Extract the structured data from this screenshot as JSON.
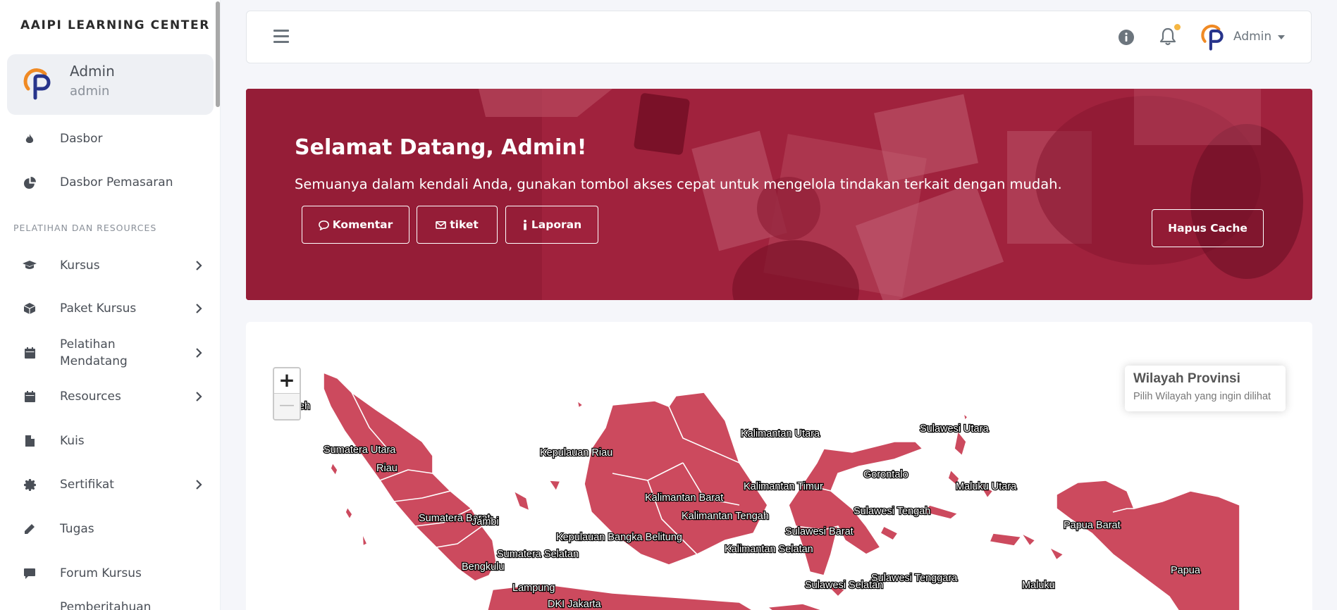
{
  "sidebar": {
    "brand": "AAIPI LEARNING CENTER",
    "user": {
      "name": "Admin",
      "role": "admin"
    },
    "section_label": "PELATIHAN DAN RESOURCES",
    "items": [
      {
        "label": "Dasbor",
        "icon": "fire-icon",
        "has_children": false
      },
      {
        "label": "Dasbor Pemasaran",
        "icon": "pie-chart-icon",
        "has_children": false
      },
      {
        "label": "Kursus",
        "icon": "graduation-cap-icon",
        "has_children": true
      },
      {
        "label": "Paket Kursus",
        "icon": "box-icon",
        "has_children": true
      },
      {
        "label": "Pelatihan Mendatang",
        "icon": "calendar-icon",
        "has_children": true
      },
      {
        "label": "Resources",
        "icon": "calendar-icon",
        "has_children": true
      },
      {
        "label": "Kuis",
        "icon": "file-icon",
        "has_children": false
      },
      {
        "label": "Sertifikat",
        "icon": "certificate-icon",
        "has_children": true
      },
      {
        "label": "Tugas",
        "icon": "pencil-icon",
        "has_children": false
      },
      {
        "label": "Forum Kursus",
        "icon": "comment-icon",
        "has_children": false
      },
      {
        "label": "Pemberitahuan",
        "icon": "bell-icon",
        "has_children": false
      }
    ]
  },
  "topbar": {
    "user_label": "Admin",
    "icons": [
      "menu-icon",
      "info-icon",
      "bell-icon"
    ],
    "notification_dot_color": "#f5b642"
  },
  "banner": {
    "title": "Selamat Datang, Admin!",
    "subtitle": "Semuanya dalam kendali Anda, gunakan tombol akses cepat untuk mengelola tindakan terkait dengan mudah.",
    "buttons": {
      "komentar": "Komentar",
      "tiket": "tiket",
      "laporan": "Laporan",
      "cache": "Hapus Cache"
    },
    "color": "#9c1c36"
  },
  "map": {
    "info_title": "Wilayah Provinsi",
    "info_subtitle": "Pilih Wilayah yang ingin dilihat",
    "region_color": "#cc4a5e",
    "zoom_in": "+",
    "zoom_out": "—",
    "provinces": [
      "Aceh",
      "Sumatera Utara",
      "Riau",
      "Kepulauan Riau",
      "Sumatera Barat",
      "Jambi",
      "Kepulauan Bangka Belitung",
      "Sumatera Selatan",
      "Bengkulu",
      "Lampung",
      "DKI Jakarta",
      "Kalimantan Utara",
      "Kalimantan Barat",
      "Kalimantan Timur",
      "Kalimantan Tengah",
      "Kalimantan Selatan",
      "Sulawesi Utara",
      "Gorontalo",
      "Sulawesi Tengah",
      "Sulawesi Barat",
      "Sulawesi Selatan",
      "Sulawesi Tenggara",
      "Maluku Utara",
      "Maluku",
      "Papua Barat",
      "Papua"
    ]
  }
}
